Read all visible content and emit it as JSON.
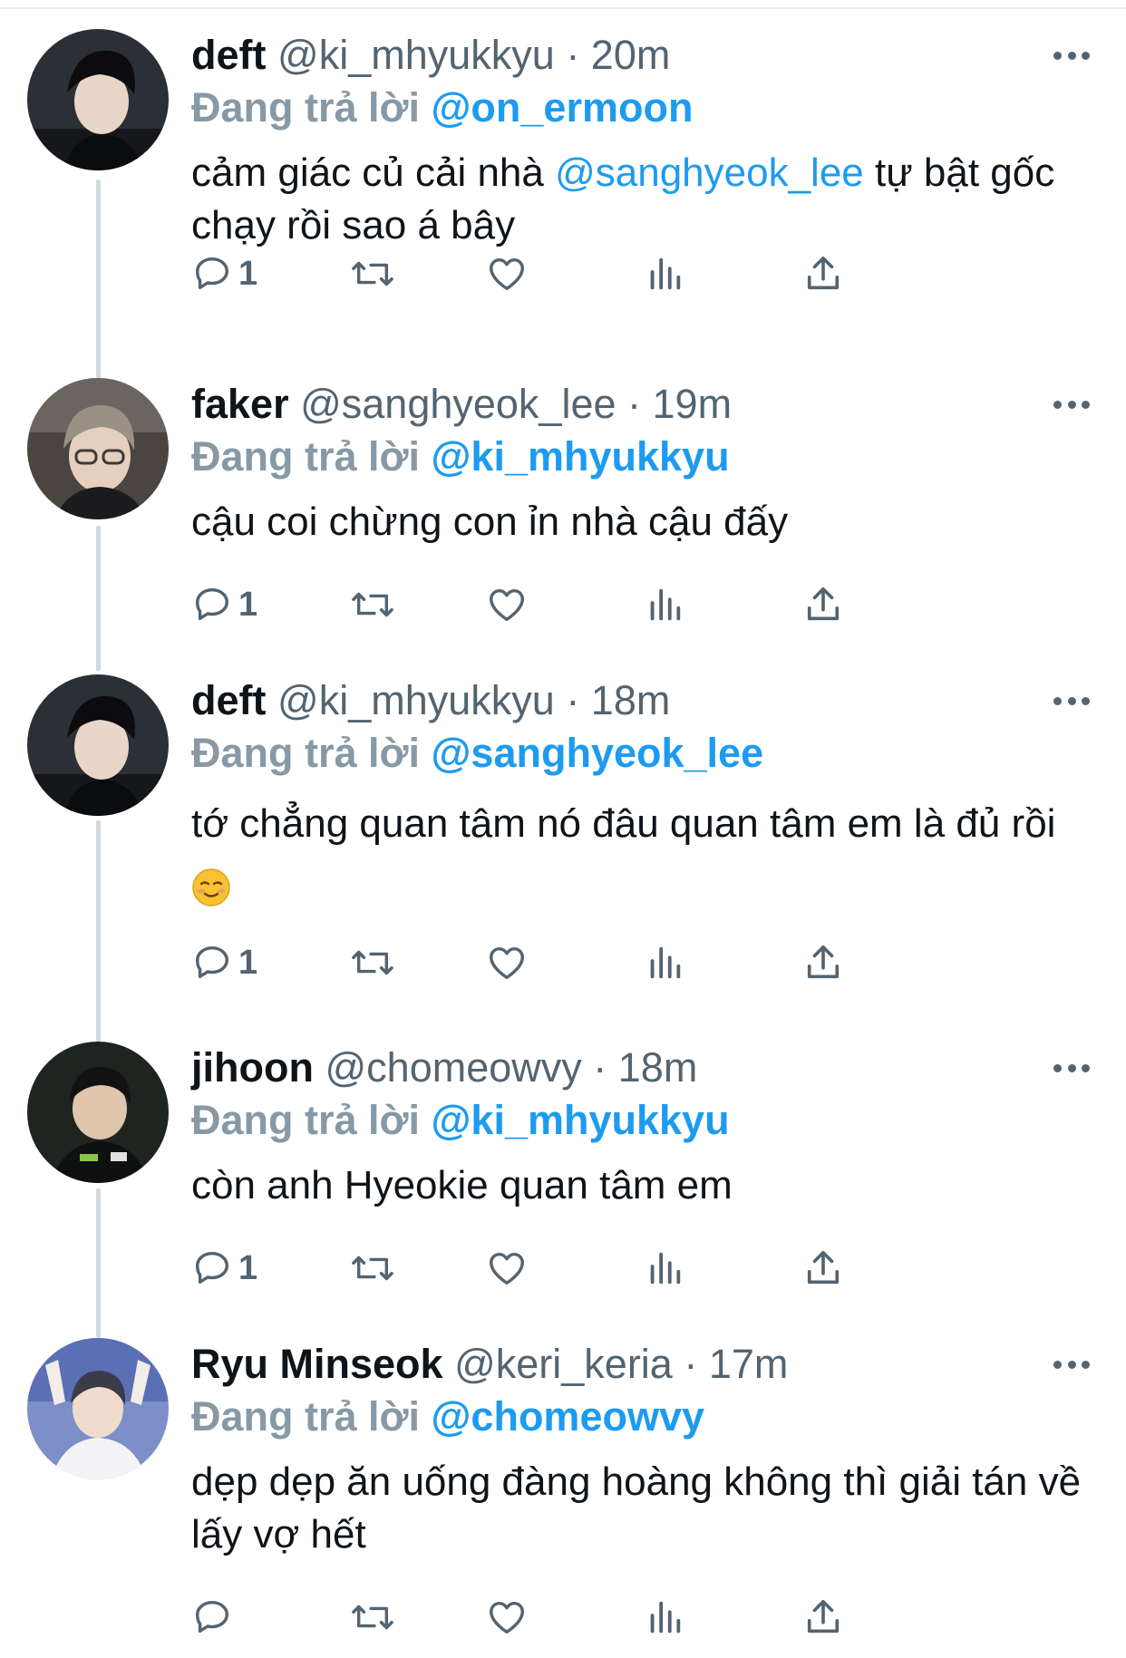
{
  "tweets": [
    {
      "name": "deft",
      "handle": "@ki_mhyukkyu",
      "time": "· 20m",
      "reply_prefix": "Đang trả lời",
      "reply_to": "@on_ermoon",
      "text_1": "cảm giác củ cải nhà ",
      "text_link": "@sanghyeok_lee",
      "text_2": " tự bật gốc chạy rồi sao á bây",
      "reply_count": "1"
    },
    {
      "name": "faker",
      "handle": "@sanghyeok_lee",
      "time": "· 19m",
      "reply_prefix": "Đang trả lời",
      "reply_to": "@ki_mhyukkyu",
      "text_1": "cậu coi chừng con ỉn nhà cậu đấy",
      "reply_count": "1"
    },
    {
      "name": "deft",
      "handle": "@ki_mhyukkyu",
      "time": "· 18m",
      "reply_prefix": "Đang trả lời",
      "reply_to": "@sanghyeok_lee",
      "text_1": "tớ chẳng quan tâm nó đâu quan tâm em là đủ rồi",
      "reply_count": "1"
    },
    {
      "name": "jihoon",
      "handle": "@chomeowvy",
      "time": "· 18m",
      "reply_prefix": "Đang trả lời",
      "reply_to": "@ki_mhyukkyu",
      "text_1": "còn anh Hyeokie quan tâm em",
      "reply_count": "1"
    },
    {
      "name": "Ryu Minseok",
      "handle": "@keri_keria",
      "time": "· 17m",
      "reply_prefix": "Đang trả lời",
      "reply_to": "@chomeowvy",
      "text_1": "dẹp dẹp ăn uống đàng hoàng không thì giải tán về lấy vợ hết",
      "reply_count": ""
    }
  ],
  "icons": {
    "reply": "reply-icon",
    "retweet": "retweet-icon",
    "like": "heart-icon",
    "views": "analytics-icon",
    "share": "share-icon",
    "more": "more-icon"
  },
  "colors": {
    "accent": "#1d9bf0",
    "secondary_text": "#536471",
    "reply_label": "#8899a6",
    "thread_line": "#cfd9de"
  }
}
